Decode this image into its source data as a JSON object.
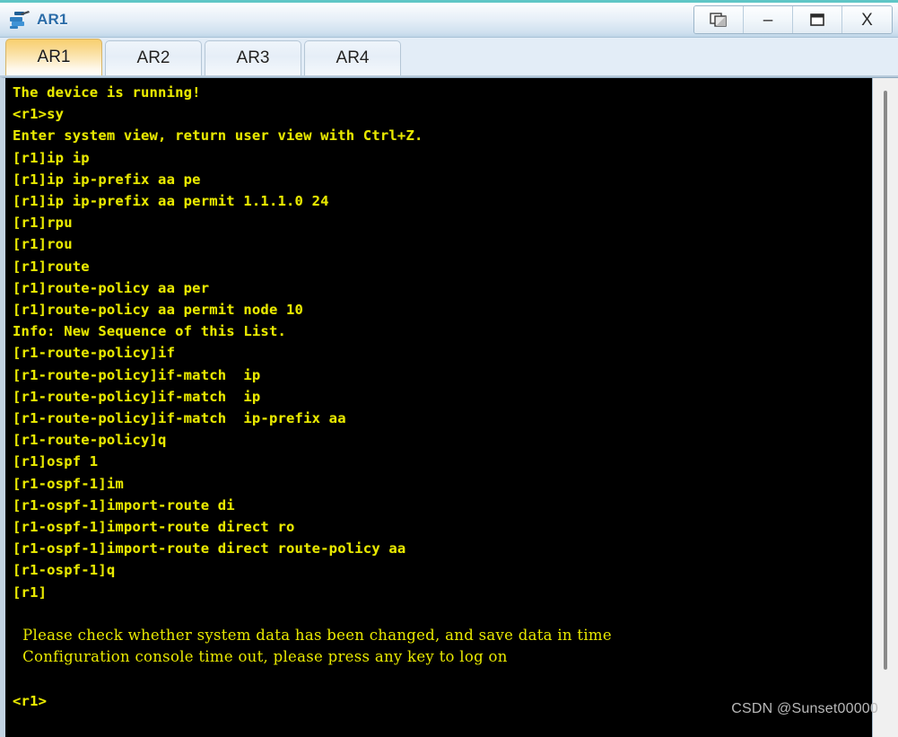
{
  "window": {
    "title": "AR1",
    "icon": "router-icon",
    "controls": [
      {
        "name": "restore-window-button",
        "icon": "restore-icon",
        "label": ""
      },
      {
        "name": "minimize-window-button",
        "icon": "minimize-icon",
        "label": "–"
      },
      {
        "name": "maximize-window-button",
        "icon": "maximize-icon",
        "label": ""
      },
      {
        "name": "close-window-button",
        "icon": "close-icon",
        "label": "X"
      }
    ]
  },
  "tabs": [
    {
      "label": "AR1",
      "active": true
    },
    {
      "label": "AR2",
      "active": false
    },
    {
      "label": "AR3",
      "active": false
    },
    {
      "label": "AR4",
      "active": false
    }
  ],
  "terminal": {
    "text_color": "#e9e900",
    "background_color": "#000000",
    "lines": [
      "The device is running!",
      "",
      "<r1>sy",
      "Enter system view, return user view with Ctrl+Z.",
      "[r1]ip ip",
      "[r1]ip ip-prefix aa pe",
      "[r1]ip ip-prefix aa permit 1.1.1.0 24",
      "[r1]rpu",
      "[r1]rou",
      "[r1]route",
      "[r1]route-policy aa per",
      "[r1]route-policy aa permit node 10",
      "Info: New Sequence of this List.",
      "[r1-route-policy]if",
      "[r1-route-policy]if-match  ip",
      "[r1-route-policy]if-match  ip",
      "[r1-route-policy]if-match  ip-prefix aa",
      "[r1-route-policy]q",
      "[r1]ospf 1",
      "[r1-ospf-1]im",
      "[r1-ospf-1]import-route di",
      "[r1-ospf-1]import-route direct ro",
      "[r1-ospf-1]import-route direct route-policy aa",
      "[r1-ospf-1]q",
      "[r1]"
    ],
    "notices": [
      "  Please check whether system data has been changed, and save data in time",
      "",
      "  Configuration console time out, please press any key to log on"
    ],
    "final_prompt": "<r1>",
    "scrollbar": {
      "name": "vertical-scrollbar"
    }
  },
  "watermark": {
    "text": "CSDN @Sunset00000"
  }
}
